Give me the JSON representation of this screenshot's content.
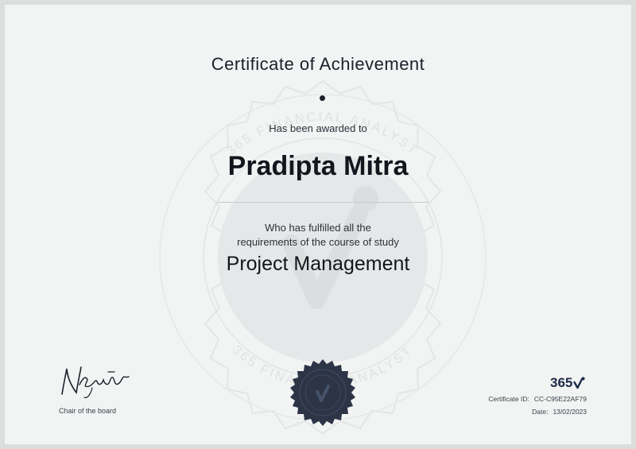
{
  "certificate": {
    "title": "Certificate of Achievement",
    "awarded_text": "Has been awarded to",
    "recipient": "Pradipta Mitra",
    "fulfilled_line1": "Who has fulfilled all the",
    "fulfilled_line2": "requirements of the course of study",
    "course": "Project Management"
  },
  "watermark": {
    "top_text": "365 FINANCIAL ANALYST",
    "bottom_text": "365 FINANCIAL ANALYST"
  },
  "signature": {
    "caption": "Chair of the board"
  },
  "branding": {
    "logo_text": "365",
    "logo_icon": "checkmark-icon"
  },
  "details": {
    "id_label": "Certificate ID:",
    "id_value": "CC-C95E22AF79",
    "date_label": "Date:",
    "date_value": "13/02/2023"
  },
  "colors": {
    "background": "#f2f3f3",
    "text": "#151a22",
    "seal": "#2c3446",
    "brand": "#1e2b4a"
  }
}
